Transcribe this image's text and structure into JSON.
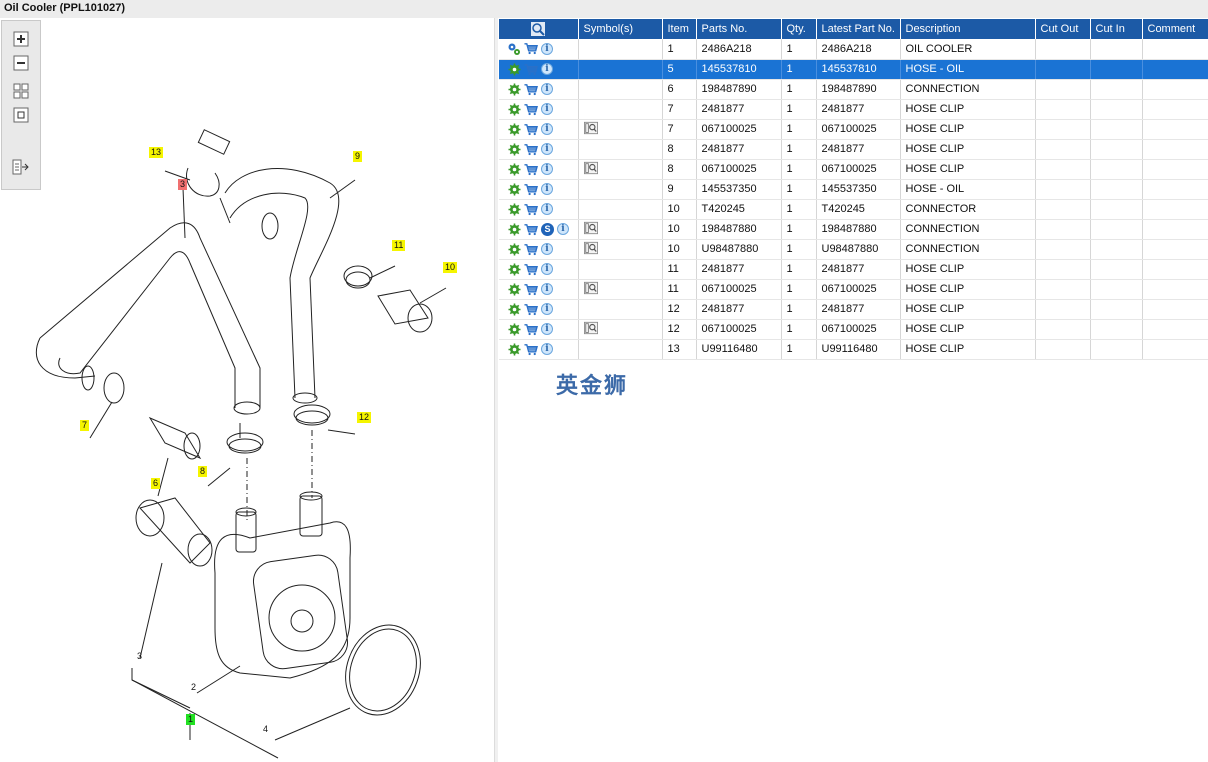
{
  "window": {
    "title": "Oil Cooler (PPL101027)"
  },
  "toolbar": {
    "buttons": [
      "zoom-in",
      "zoom-out",
      "fit-all",
      "fit-page",
      "export-list"
    ]
  },
  "diagram": {
    "callouts": [
      {
        "label": "13",
        "style": "yellow"
      },
      {
        "label": "3",
        "style": "red"
      },
      {
        "label": "9",
        "style": "yellow"
      },
      {
        "label": "11",
        "style": "yellow"
      },
      {
        "label": "10",
        "style": "yellow"
      },
      {
        "label": "7",
        "style": "yellow"
      },
      {
        "label": "12",
        "style": "yellow"
      },
      {
        "label": "6",
        "style": "yellow"
      },
      {
        "label": "8",
        "style": "yellow"
      },
      {
        "label": "3",
        "style": "plain"
      },
      {
        "label": "2",
        "style": "plain"
      },
      {
        "label": "1",
        "style": "green"
      },
      {
        "label": "4",
        "style": "plain"
      }
    ]
  },
  "table": {
    "columns": [
      "",
      "Symbol(s)",
      "Item",
      "Parts No.",
      "Qty.",
      "Latest Part No.",
      "Description",
      "Cut Out",
      "Cut In",
      "Comment"
    ],
    "selected_row": 1,
    "rows": [
      {
        "first_icon": "gears",
        "s_badge": false,
        "symbol": false,
        "item": "1",
        "part": "2486A218",
        "qty": "1",
        "latest": "2486A218",
        "desc": "OIL COOLER"
      },
      {
        "first_icon": "gear",
        "s_badge": false,
        "symbol": false,
        "item": "5",
        "part": "145537810",
        "qty": "1",
        "latest": "145537810",
        "desc": "HOSE - OIL"
      },
      {
        "first_icon": "gear",
        "s_badge": false,
        "symbol": false,
        "item": "6",
        "part": "198487890",
        "qty": "1",
        "latest": "198487890",
        "desc": "CONNECTION"
      },
      {
        "first_icon": "gear",
        "s_badge": false,
        "symbol": false,
        "item": "7",
        "part": "2481877",
        "qty": "1",
        "latest": "2481877",
        "desc": "HOSE CLIP"
      },
      {
        "first_icon": "gear",
        "s_badge": false,
        "symbol": true,
        "item": "7",
        "part": "067100025",
        "qty": "1",
        "latest": "067100025",
        "desc": "HOSE CLIP"
      },
      {
        "first_icon": "gear",
        "s_badge": false,
        "symbol": false,
        "item": "8",
        "part": "2481877",
        "qty": "1",
        "latest": "2481877",
        "desc": "HOSE CLIP"
      },
      {
        "first_icon": "gear",
        "s_badge": false,
        "symbol": true,
        "item": "8",
        "part": "067100025",
        "qty": "1",
        "latest": "067100025",
        "desc": "HOSE CLIP"
      },
      {
        "first_icon": "gear",
        "s_badge": false,
        "symbol": false,
        "item": "9",
        "part": "145537350",
        "qty": "1",
        "latest": "145537350",
        "desc": "HOSE - OIL"
      },
      {
        "first_icon": "gear",
        "s_badge": false,
        "symbol": false,
        "item": "10",
        "part": "T420245",
        "qty": "1",
        "latest": "T420245",
        "desc": "CONNECTOR"
      },
      {
        "first_icon": "gear",
        "s_badge": true,
        "symbol": true,
        "item": "10",
        "part": "198487880",
        "qty": "1",
        "latest": "198487880",
        "desc": "CONNECTION"
      },
      {
        "first_icon": "gear",
        "s_badge": false,
        "symbol": true,
        "item": "10",
        "part": "U98487880",
        "qty": "1",
        "latest": "U98487880",
        "desc": "CONNECTION"
      },
      {
        "first_icon": "gear",
        "s_badge": false,
        "symbol": false,
        "item": "11",
        "part": "2481877",
        "qty": "1",
        "latest": "2481877",
        "desc": "HOSE CLIP"
      },
      {
        "first_icon": "gear",
        "s_badge": false,
        "symbol": true,
        "item": "11",
        "part": "067100025",
        "qty": "1",
        "latest": "067100025",
        "desc": "HOSE CLIP"
      },
      {
        "first_icon": "gear",
        "s_badge": false,
        "symbol": false,
        "item": "12",
        "part": "2481877",
        "qty": "1",
        "latest": "2481877",
        "desc": "HOSE CLIP"
      },
      {
        "first_icon": "gear",
        "s_badge": false,
        "symbol": true,
        "item": "12",
        "part": "067100025",
        "qty": "1",
        "latest": "067100025",
        "desc": "HOSE CLIP"
      },
      {
        "first_icon": "gear",
        "s_badge": false,
        "symbol": false,
        "item": "13",
        "part": "U99116480",
        "qty": "1",
        "latest": "U99116480",
        "desc": "HOSE CLIP"
      }
    ]
  },
  "watermark": "英金狮",
  "colors": {
    "header": "#1c5aa6",
    "selected_row": "#1a73d4",
    "gear_green": "#3a9a2a",
    "cart_blue": "#2a70c8"
  }
}
